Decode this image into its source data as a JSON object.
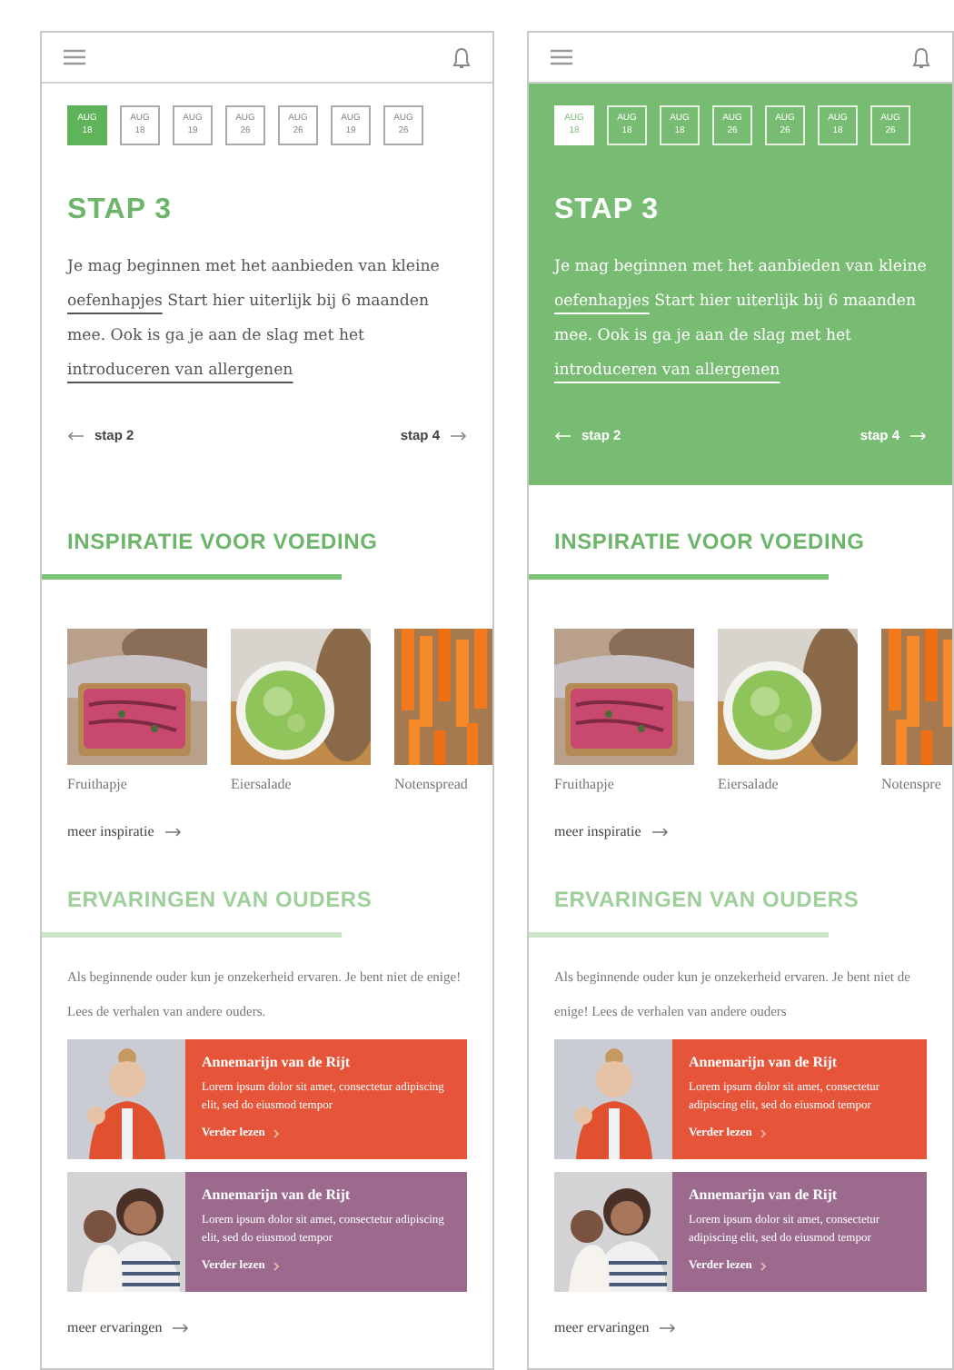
{
  "screens": [
    {
      "step_highlighted": false,
      "dates": [
        {
          "month": "AUG",
          "day": "18",
          "selected": true
        },
        {
          "month": "AUG",
          "day": "18",
          "selected": false
        },
        {
          "month": "AUG",
          "day": "19",
          "selected": false
        },
        {
          "month": "AUG",
          "day": "26",
          "selected": false
        },
        {
          "month": "AUG",
          "day": "26",
          "selected": false
        },
        {
          "month": "AUG",
          "day": "19",
          "selected": false
        },
        {
          "month": "AUG",
          "day": "26",
          "selected": false
        }
      ],
      "step": {
        "title": "STAP 3",
        "text": [
          {
            "kind": "text",
            "text": "Je mag beginnen met het aanbieden van kleine "
          },
          {
            "kind": "link",
            "text": "oefenhapjes"
          },
          {
            "kind": "text",
            "text": " Start hier uiterlijk bij 6 maanden mee. Ook is ga je aan de slag met het "
          },
          {
            "kind": "link",
            "text": "introduceren van allergenen"
          }
        ],
        "prev": "stap 2",
        "next": "stap 4"
      },
      "inspiration": {
        "title": "INSPIRATIE VOOR VOEDING",
        "items": [
          {
            "label": "Fruithapje"
          },
          {
            "label": "Eiersalade"
          },
          {
            "label": "Notenspread"
          }
        ],
        "more": "meer inspiratie"
      },
      "experiences": {
        "title": "ERVARINGEN VAN OUDERS",
        "intro": "Als beginnende ouder kun je onzekerheid ervaren. Je bent niet de enige! Lees de verhalen van andere ouders.",
        "cards": [
          {
            "name": "Annemarijn van de Rijt",
            "text": "Lorem ipsum dolor sit amet, consectetur adipiscing elit, sed do eiusmod tempor",
            "link": "Verder lezen",
            "color": "#e6553a"
          },
          {
            "name": "Annemarijn van de Rijt",
            "text": "Lorem ipsum dolor sit amet, consectetur adipiscing elit, sed do eiusmod tempor",
            "link": "Verder lezen",
            "color": "#9b6a8d"
          }
        ],
        "more": "meer ervaringen"
      }
    },
    {
      "step_highlighted": true,
      "dates": [
        {
          "month": "AUG",
          "day": "18",
          "selected": true
        },
        {
          "month": "AUG",
          "day": "18",
          "selected": false
        },
        {
          "month": "AUG",
          "day": "18",
          "selected": false
        },
        {
          "month": "AUG",
          "day": "26",
          "selected": false
        },
        {
          "month": "AUG",
          "day": "26",
          "selected": false
        },
        {
          "month": "AUG",
          "day": "18",
          "selected": false
        },
        {
          "month": "AUG",
          "day": "26",
          "selected": false
        }
      ],
      "step": {
        "title": "STAP 3",
        "text": [
          {
            "kind": "text",
            "text": "Je mag beginnen met het aanbieden van kleine "
          },
          {
            "kind": "link",
            "text": "oefenhapjes"
          },
          {
            "kind": "text",
            "text": " Start hier uiterlijk bij 6 maanden mee. Ook is ga je aan de slag met het "
          },
          {
            "kind": "link",
            "text": "introduceren van allergenen"
          }
        ],
        "prev": "stap 2",
        "next": "stap 4"
      },
      "inspiration": {
        "title": "INSPIRATIE VOOR VOEDING",
        "items": [
          {
            "label": "Fruithapje"
          },
          {
            "label": "Eiersalade"
          },
          {
            "label": "Notenspre"
          }
        ],
        "more": "meer inspiratie"
      },
      "experiences": {
        "title": "ERVARINGEN VAN OUDERS",
        "intro": "Als beginnende ouder kun je onzekerheid ervaren. Je bent niet de enige! Lees de verhalen van andere ouders",
        "cards": [
          {
            "name": "Annemarijn van de Rijt",
            "text": "Lorem ipsum dolor sit amet, consectetur adipiscing elit, sed do eiusmod tempor",
            "link": "Verder lezen",
            "color": "#e6553a"
          },
          {
            "name": "Annemarijn van de Rijt",
            "text": "Lorem ipsum dolor sit amet, consectetur adipiscing elit, sed do eiusmod tempor",
            "link": "Verder lezen",
            "color": "#9b6a8d"
          }
        ],
        "more": "meer ervaringen"
      }
    }
  ]
}
